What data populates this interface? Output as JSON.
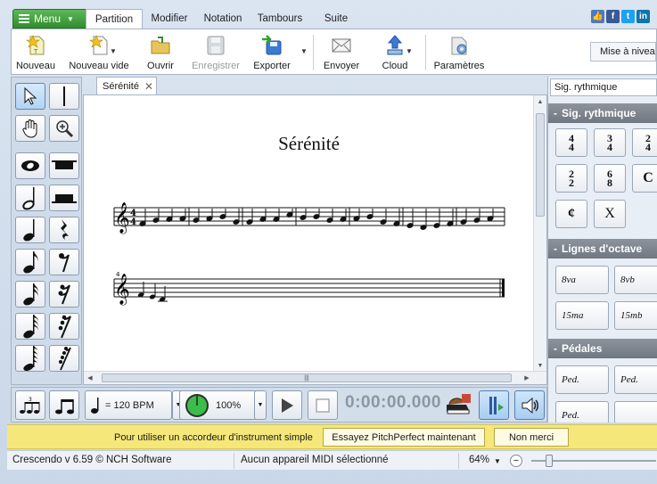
{
  "menu": {
    "label": "Menu"
  },
  "tabs": [
    "Partition",
    "Modifier",
    "Notation",
    "Tambours",
    "Suite"
  ],
  "toolbar": {
    "new": "Nouveau",
    "new_blank": "Nouveau vide",
    "open": "Ouvrir",
    "save": "Enregistrer",
    "export": "Exporter",
    "send": "Envoyer",
    "cloud": "Cloud",
    "settings": "Paramètres",
    "upgrade": "Mise à niveau"
  },
  "document": {
    "tab_title": "Sérénité",
    "score_title": "Sérénité"
  },
  "right_panel": {
    "dropdown": "Sig. rythmique",
    "sections": [
      "Sig. rythmique",
      "Lignes d'octave",
      "Pédales"
    ],
    "time_signatures": [
      [
        "4",
        "4"
      ],
      [
        "3",
        "4"
      ],
      [
        "2",
        "4"
      ],
      [
        "2",
        "2"
      ],
      [
        "6",
        "8"
      ],
      [
        "C",
        ""
      ],
      [
        "¢",
        ""
      ],
      [
        "X",
        ""
      ]
    ],
    "octave_lines": [
      "8va",
      "8vb",
      "15ma",
      "15mb"
    ],
    "pedals": [
      "Ped.",
      "Ped.",
      "Ped.",
      ""
    ]
  },
  "transport": {
    "tempo": "= 120 BPM",
    "speed": "100%",
    "time": "0:00:00.000"
  },
  "notification": {
    "message": "Pour utiliser un accordeur d'instrument simple",
    "try_button": "Essayez PitchPerfect maintenant",
    "no_button": "Non merci"
  },
  "status": {
    "version": "Crescendo v 6.59 © NCH Software",
    "midi": "Aucun appareil MIDI sélectionné",
    "zoom": "64%"
  },
  "colors": {
    "menu_green": "#2f8d2b",
    "notify_yellow": "#f6e77a",
    "header_gray": "#7a828c"
  }
}
